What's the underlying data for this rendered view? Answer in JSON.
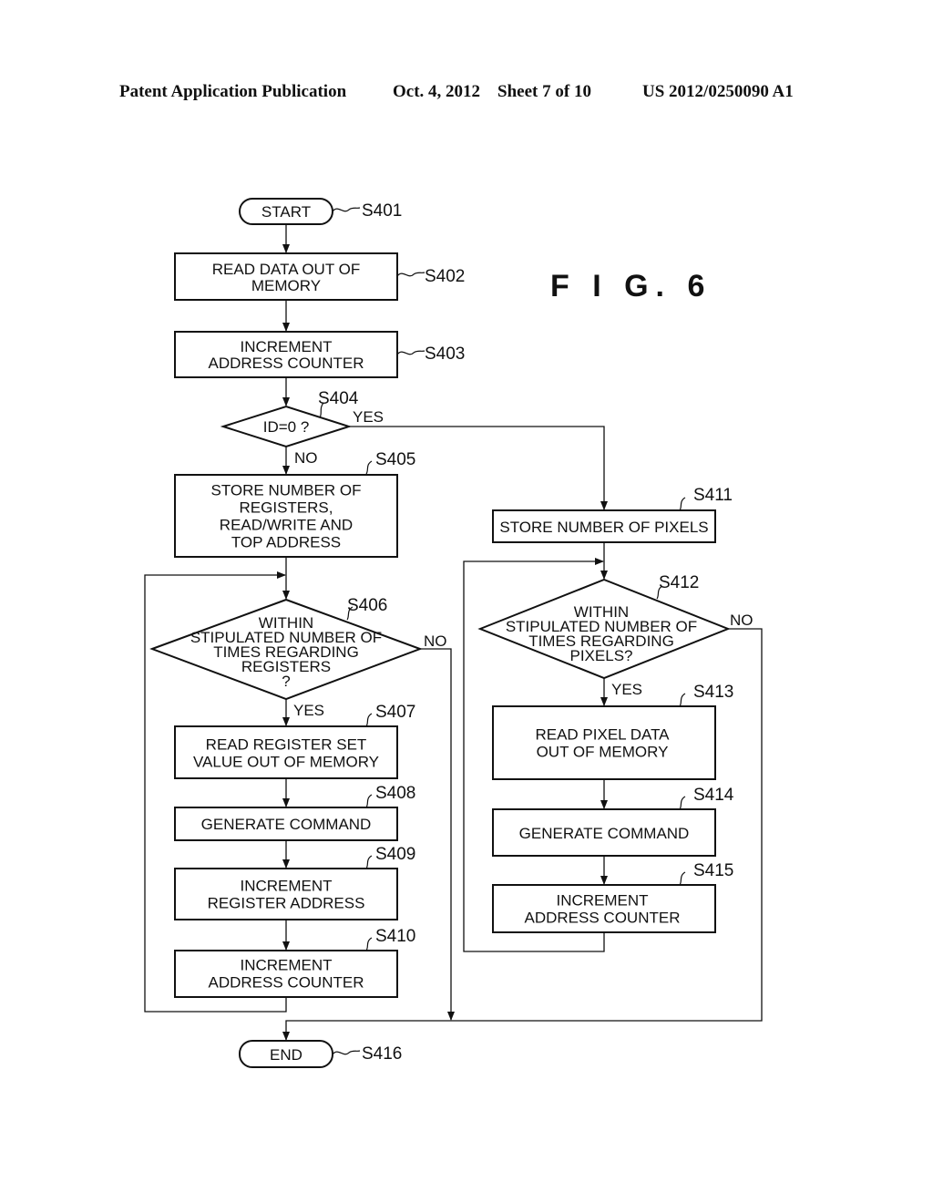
{
  "header": {
    "publication": "Patent Application Publication",
    "date_sheet": "Oct. 4, 2012    Sheet 7 of 10",
    "number": "US 2012/0250090 A1"
  },
  "figure_label": "F I G.  6",
  "steps": {
    "s401": {
      "id": "S401",
      "lines": [
        "START"
      ]
    },
    "s402": {
      "id": "S402",
      "lines": [
        "READ DATA OUT OF",
        "MEMORY"
      ]
    },
    "s403": {
      "id": "S403",
      "lines": [
        "INCREMENT",
        "ADDRESS COUNTER"
      ]
    },
    "s404": {
      "id": "S404",
      "lines": [
        "ID=0 ?"
      ]
    },
    "s405": {
      "id": "S405",
      "lines": [
        "STORE NUMBER OF",
        "REGISTERS,",
        "READ/WRITE AND",
        "TOP ADDRESS"
      ]
    },
    "s406": {
      "id": "S406",
      "lines": [
        "WITHIN",
        "STIPULATED NUMBER OF",
        "TIMES REGARDING",
        "REGISTERS",
        "?"
      ]
    },
    "s407": {
      "id": "S407",
      "lines": [
        "READ REGISTER SET",
        "VALUE OUT OF MEMORY"
      ]
    },
    "s408": {
      "id": "S408",
      "lines": [
        "GENERATE COMMAND"
      ]
    },
    "s409": {
      "id": "S409",
      "lines": [
        "INCREMENT",
        "REGISTER ADDRESS"
      ]
    },
    "s410": {
      "id": "S410",
      "lines": [
        "INCREMENT",
        "ADDRESS COUNTER"
      ]
    },
    "s411": {
      "id": "S411",
      "lines": [
        "STORE NUMBER OF PIXELS"
      ]
    },
    "s412": {
      "id": "S412",
      "lines": [
        "WITHIN",
        "STIPULATED NUMBER OF",
        "TIMES REGARDING",
        "PIXELS?"
      ]
    },
    "s413": {
      "id": "S413",
      "lines": [
        "READ PIXEL DATA",
        "OUT OF MEMORY"
      ]
    },
    "s414": {
      "id": "S414",
      "lines": [
        "GENERATE COMMAND"
      ]
    },
    "s415": {
      "id": "S415",
      "lines": [
        "INCREMENT",
        "ADDRESS COUNTER"
      ]
    },
    "s416": {
      "id": "S416",
      "lines": [
        "END"
      ]
    }
  },
  "branch_labels": {
    "s404_yes": "YES",
    "s404_no": "NO",
    "s406_no": "NO",
    "s406_yes": "YES",
    "s412_no": "NO",
    "s412_yes": "YES"
  }
}
